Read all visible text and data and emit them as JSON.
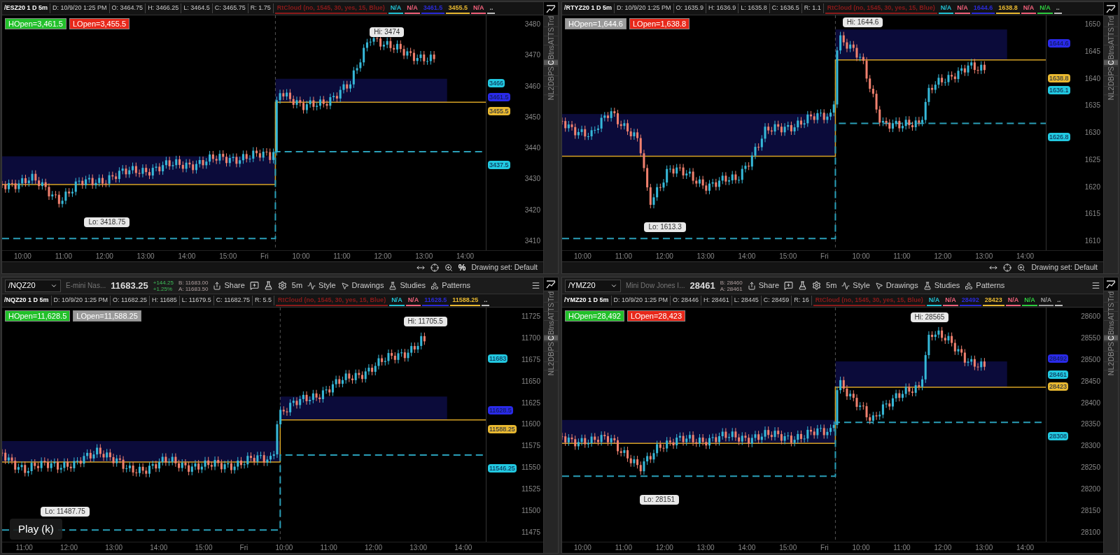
{
  "panels": [
    {
      "header": {
        "title": "/ESZ20 1 D 5m",
        "fields": [
          "D: 10/9/20 1:25 PM",
          "O: 3464.75",
          "H: 3466.25",
          "L: 3464.5",
          "C: 3465.75",
          "R: 1.75"
        ],
        "studies": [
          {
            "text": "RtCloud (no, 1545, 30, yes, 15, Blue)",
            "color": "#8b1a1a"
          },
          {
            "text": "N/A",
            "color": "#22c3d6"
          },
          {
            "text": "N/A",
            "color": "#f0607a"
          },
          {
            "text": "3461.5",
            "color": "#2a2ad8"
          },
          {
            "text": "3455.5",
            "color": "#e8b830"
          },
          {
            "text": "N/A",
            "color": "#f0607a"
          },
          {
            "text": "..",
            "color": "#bbbbbb"
          }
        ]
      },
      "open_labels": [
        {
          "text": "HOpen=3,461.5",
          "color": "#22c02a"
        },
        {
          "text": "LOpen=3,455.5",
          "color": "#e8281a"
        }
      ],
      "hi_label": "Hi: 3474",
      "lo_label": "Lo: 3418.75",
      "price_ticks": [
        "3480",
        "3470",
        "3460",
        "3450",
        "3440",
        "3430",
        "3420",
        "3410"
      ],
      "price_markers": [
        {
          "text": "3466",
          "color": "#22c8e0"
        },
        {
          "text": "3461.5",
          "color": "#2a2ae8"
        },
        {
          "text": "3455.5",
          "color": "#e8b830"
        },
        {
          "text": "3437.5",
          "color": "#22c8e0"
        }
      ],
      "time_ticks": [
        "10:00",
        "11:00",
        "12:00",
        "13:00",
        "14:00",
        "15:00",
        "Fri",
        "10:00",
        "11:00",
        "12:00",
        "13:00",
        "14:00"
      ],
      "footer": {
        "percent_toggle": "%",
        "drawing_set": "Drawing set: Default"
      },
      "side_tabs": [
        {
          "label": "Trd",
          "selected": false
        },
        {
          "label": "TS",
          "selected": false
        },
        {
          "label": "AT",
          "selected": false
        },
        {
          "label": "Btns",
          "selected": false
        },
        {
          "label": "C",
          "selected": true
        },
        {
          "label": "PS",
          "selected": false
        },
        {
          "label": "DB",
          "selected": false
        },
        {
          "label": "L2",
          "selected": false
        },
        {
          "label": "N",
          "selected": false
        }
      ]
    },
    {
      "header": {
        "title": "/RTYZ20 1 D 5m",
        "fields": [
          "D: 10/9/20 1:25 PM",
          "O: 1635.9",
          "H: 1636.9",
          "L: 1635.8",
          "C: 1636.5",
          "R: 1.1"
        ],
        "studies": [
          {
            "text": "RtCloud (no, 1545, 30, yes, 15, Blue)",
            "color": "#8b1a1a"
          },
          {
            "text": "N/A",
            "color": "#22c3d6"
          },
          {
            "text": "N/A",
            "color": "#f0607a"
          },
          {
            "text": "1644.6",
            "color": "#2a2ad8"
          },
          {
            "text": "1638.8",
            "color": "#e8b830"
          },
          {
            "text": "N/A",
            "color": "#f0607a"
          },
          {
            "text": "N/A",
            "color": "#2ecc40"
          },
          {
            "text": "..",
            "color": "#bbbbbb"
          }
        ]
      },
      "open_labels": [
        {
          "text": "HOpen=1,644.6",
          "color": "#9a9a9a"
        },
        {
          "text": "LOpen=1,638.8",
          "color": "#e8281a"
        }
      ],
      "hi_label": "Hi: 1644.6",
      "lo_label": "Lo: 1613.3",
      "price_ticks": [
        "1650",
        "1645",
        "1640",
        "1635",
        "1630",
        "1625",
        "1620",
        "1615",
        "1610"
      ],
      "price_markers": [
        {
          "text": "1644.6",
          "color": "#2a2ae8"
        },
        {
          "text": "1638.8",
          "color": "#e8b830"
        },
        {
          "text": "1636.1",
          "color": "#22c8e0"
        },
        {
          "text": "1626.8",
          "color": "#22c8e0"
        }
      ],
      "time_ticks": [
        "10:00",
        "11:00",
        "12:00",
        "13:00",
        "14:00",
        "15:00",
        "Fri",
        "10:00",
        "11:00",
        "12:00",
        "13:00",
        "14:00"
      ],
      "footer": {
        "drawing_set": "Drawing set: Default"
      },
      "side_tabs": [
        {
          "label": "Trd",
          "selected": false
        },
        {
          "label": "TS",
          "selected": false
        },
        {
          "label": "AT",
          "selected": false
        },
        {
          "label": "Btns",
          "selected": false
        },
        {
          "label": "C",
          "selected": true
        },
        {
          "label": "PS",
          "selected": false
        },
        {
          "label": "DB",
          "selected": false
        },
        {
          "label": "L2",
          "selected": false
        },
        {
          "label": "N",
          "selected": false
        }
      ]
    },
    {
      "toolbar": {
        "symbol": "/NQZ20",
        "description": "E-mini Nas...",
        "last": "11683.25",
        "change": "+144.25",
        "change_pct": "+1.25%",
        "bid": "B: 11683.00",
        "ask": "A: 11683.50",
        "buttons": [
          {
            "kind": "share",
            "label": "Share"
          },
          {
            "kind": "interval",
            "label": "5m"
          },
          {
            "kind": "style",
            "label": "Style"
          },
          {
            "kind": "drawings",
            "label": "Drawings"
          },
          {
            "kind": "studies",
            "label": "Studies"
          },
          {
            "kind": "patterns",
            "label": "Patterns"
          }
        ]
      },
      "header": {
        "title": "/NQZ20 1 D 5m",
        "fields": [
          "D: 10/9/20 1:25 PM",
          "O: 11682.25",
          "H: 11685",
          "L: 11679.5",
          "C: 11682.75",
          "R: 5.5"
        ],
        "studies": [
          {
            "text": "RtCloud (no, 1545, 30, yes, 15, Blue)",
            "color": "#8b1a1a"
          },
          {
            "text": "N/A",
            "color": "#22c3d6"
          },
          {
            "text": "N/A",
            "color": "#f0607a"
          },
          {
            "text": "11628.5",
            "color": "#2a2ad8"
          },
          {
            "text": "11588.25",
            "color": "#e8b830"
          },
          {
            "text": "..",
            "color": "#bbbbbb"
          }
        ]
      },
      "open_labels": [
        {
          "text": "HOpen=11,628.5",
          "color": "#22c02a"
        },
        {
          "text": "LOpen=11,588.25",
          "color": "#9a9a9a"
        }
      ],
      "hi_label": "Hi: 11705.5",
      "lo_label": "Lo: 11487.75",
      "price_ticks": [
        "11725",
        "11700",
        "11675",
        "11650",
        "11625",
        "11600",
        "11575",
        "11550",
        "11525",
        "11500",
        "11475"
      ],
      "price_markers": [
        {
          "text": "11683",
          "color": "#22c8e0"
        },
        {
          "text": "11628.5",
          "color": "#2a2ae8"
        },
        {
          "text": "11588.25",
          "color": "#e8b830"
        },
        {
          "text": "11546.25",
          "color": "#22c8e0"
        }
      ],
      "time_ticks": [
        "11:00",
        "12:00",
        "13:00",
        "14:00",
        "15:00",
        "Fri",
        "10:00",
        "11:00",
        "12:00",
        "13:00",
        "14:00"
      ],
      "side_tabs": [
        {
          "label": "Trd",
          "selected": false
        },
        {
          "label": "TS",
          "selected": false
        },
        {
          "label": "AT",
          "selected": false
        },
        {
          "label": "Btns",
          "selected": false
        },
        {
          "label": "C",
          "selected": true
        },
        {
          "label": "PS",
          "selected": false
        },
        {
          "label": "DB",
          "selected": false
        },
        {
          "label": "L2",
          "selected": false
        },
        {
          "label": "N",
          "selected": false
        }
      ]
    },
    {
      "toolbar": {
        "symbol": "/YMZ20",
        "description": "Mini Dow Jones I...",
        "last": "28461",
        "bid": "B: 28460",
        "ask": "A: 28461",
        "buttons": [
          {
            "kind": "share",
            "label": "Share"
          },
          {
            "kind": "interval",
            "label": "5m"
          },
          {
            "kind": "style",
            "label": "Style"
          },
          {
            "kind": "drawings",
            "label": "Drawings"
          },
          {
            "kind": "studies",
            "label": "Studies"
          },
          {
            "kind": "patterns",
            "label": "Patterns"
          }
        ]
      },
      "header": {
        "title": "/YMZ20 1 D 5m",
        "fields": [
          "D: 10/9/20 1:25 PM",
          "O: 28446",
          "H: 28461",
          "L: 28445",
          "C: 28459",
          "R: 16"
        ],
        "studies": [
          {
            "text": "RtCloud (no, 1545, 30, yes, 15, Blue)",
            "color": "#8b1a1a"
          },
          {
            "text": "N/A",
            "color": "#22c3d6"
          },
          {
            "text": "N/A",
            "color": "#f0607a"
          },
          {
            "text": "28492",
            "color": "#2a2ad8"
          },
          {
            "text": "28423",
            "color": "#e8b830"
          },
          {
            "text": "N/A",
            "color": "#f0607a"
          },
          {
            "text": "N/A",
            "color": "#2ecc40"
          },
          {
            "text": "N/A",
            "color": "#9a9a9a"
          },
          {
            "text": "..",
            "color": "#bbbbbb"
          }
        ]
      },
      "open_labels": [
        {
          "text": "HOpen=28,492",
          "color": "#22c02a"
        },
        {
          "text": "LOpen=28,423",
          "color": "#e8281a"
        }
      ],
      "hi_label": "Hi: 28565",
      "lo_label": "Lo: 28151",
      "price_ticks": [
        "28600",
        "28550",
        "28500",
        "28450",
        "28400",
        "28350",
        "28300",
        "28250",
        "28200",
        "28150",
        "28100"
      ],
      "price_markers": [
        {
          "text": "28492",
          "color": "#2a2ae8"
        },
        {
          "text": "28461",
          "color": "#22c8e0"
        },
        {
          "text": "28423",
          "color": "#e8b830"
        },
        {
          "text": "28308",
          "color": "#22c8e0"
        }
      ],
      "time_ticks": [
        "10:00",
        "11:00",
        "12:00",
        "13:00",
        "14:00",
        "15:00",
        "Fri",
        "10:00",
        "11:00",
        "12:00",
        "13:00",
        "14:00"
      ],
      "side_tabs": [
        {
          "label": "Trd",
          "selected": false
        },
        {
          "label": "TS",
          "selected": false
        },
        {
          "label": "AT",
          "selected": false
        },
        {
          "label": "Btns",
          "selected": false
        },
        {
          "label": "C",
          "selected": true
        },
        {
          "label": "PS",
          "selected": false
        },
        {
          "label": "DB",
          "selected": false
        },
        {
          "label": "L2",
          "selected": false
        },
        {
          "label": "N",
          "selected": false
        }
      ]
    }
  ],
  "overlay_tooltip": "Play (k)"
}
